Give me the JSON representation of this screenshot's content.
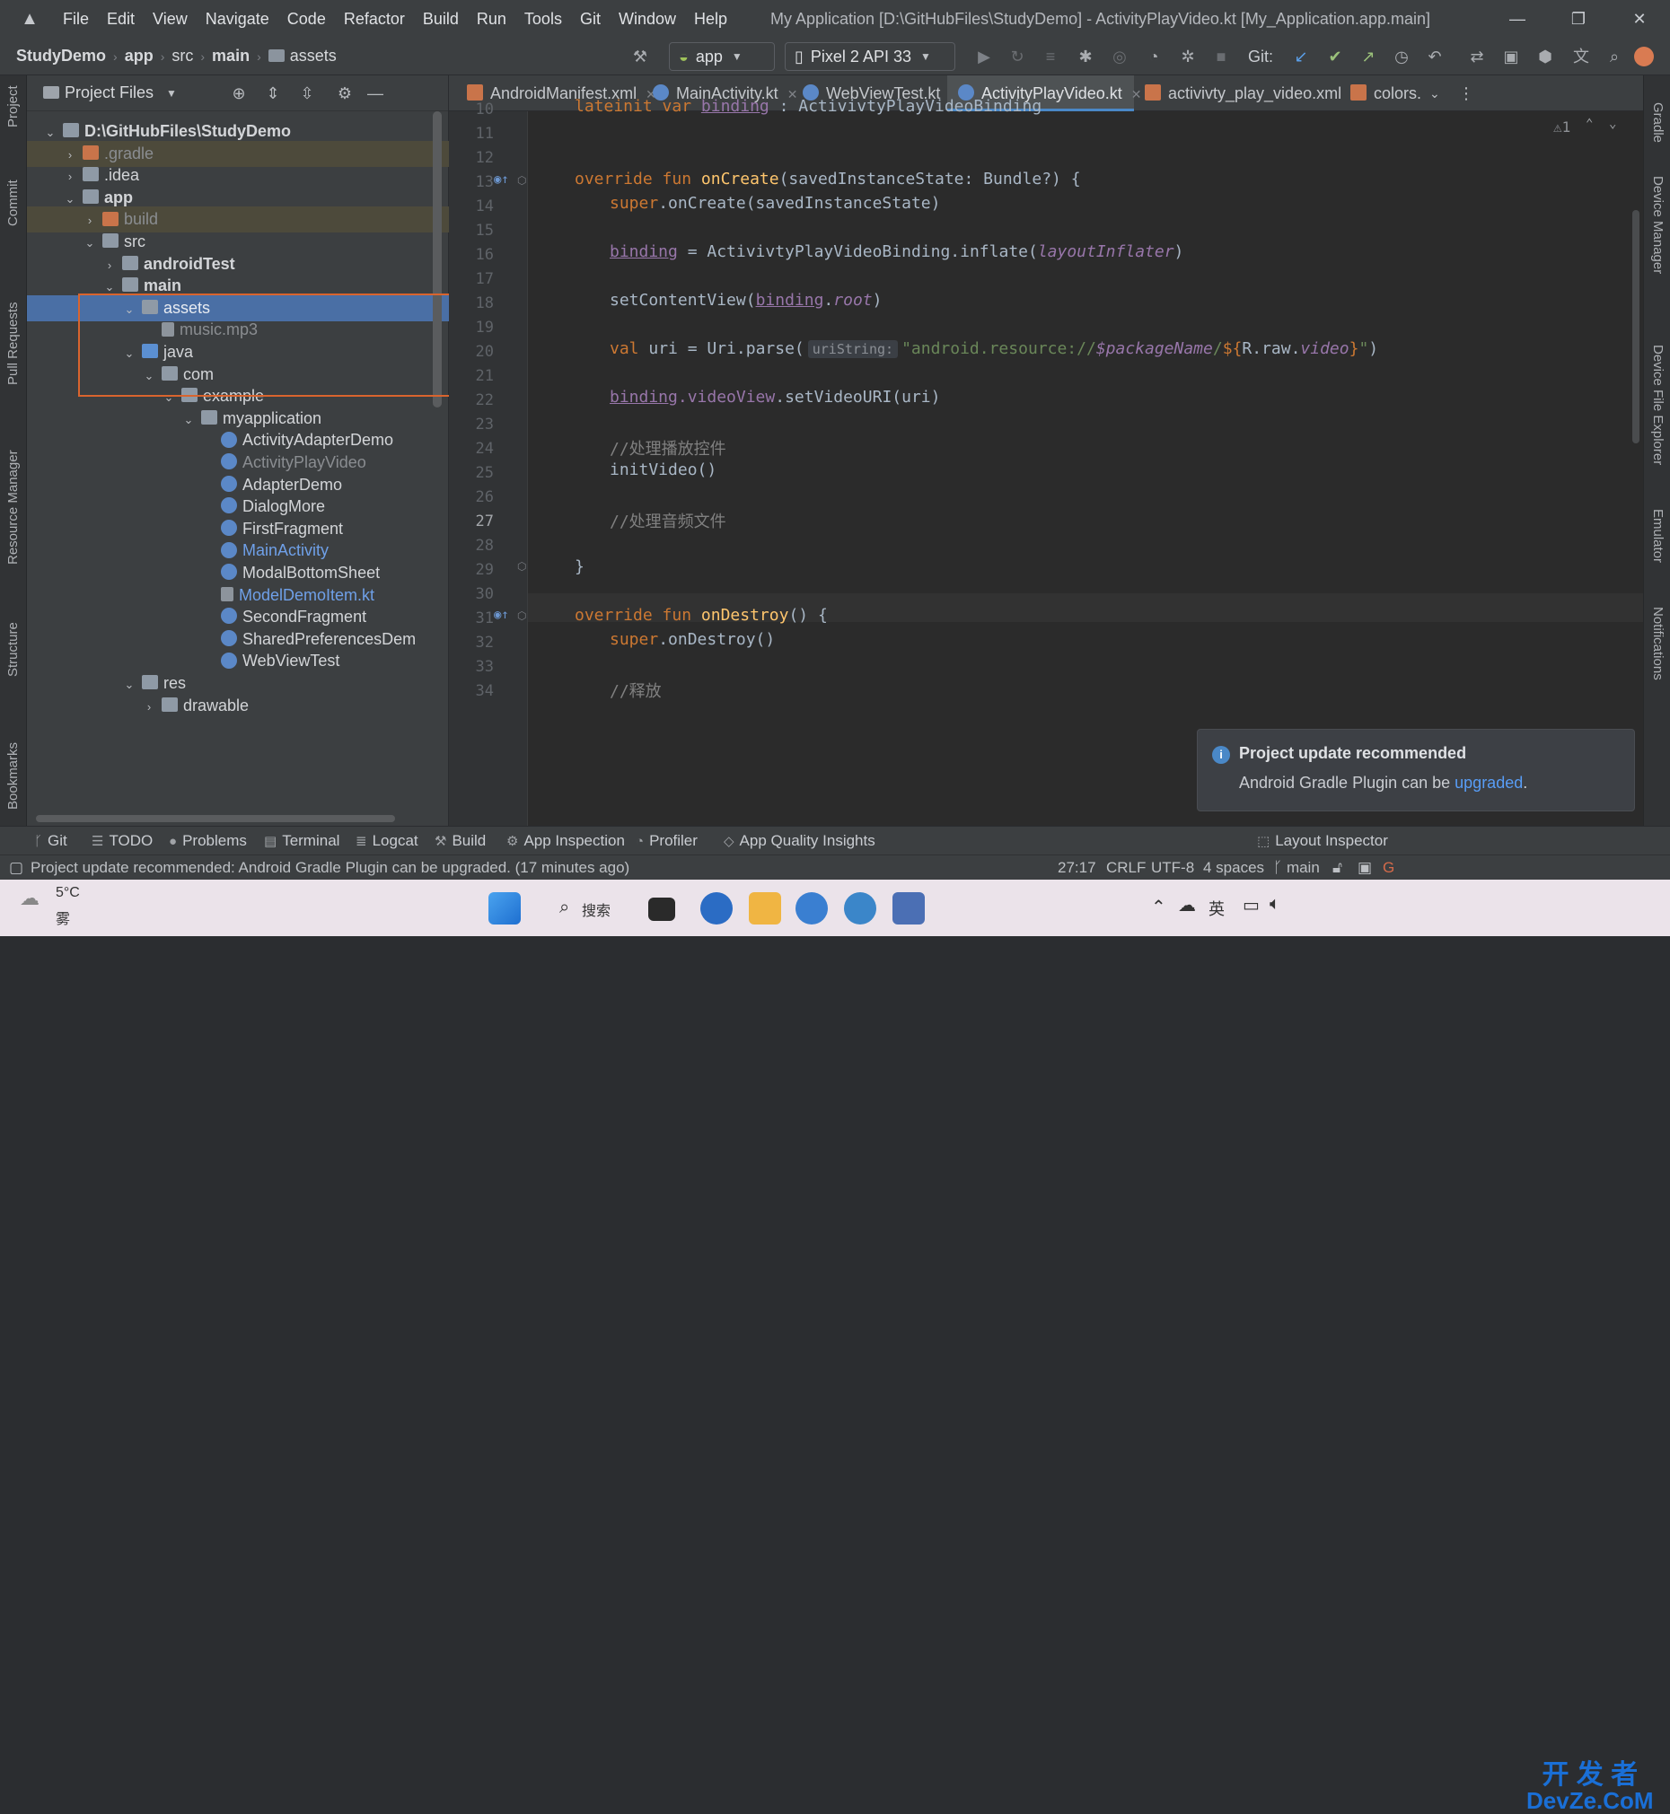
{
  "window": {
    "title": "My Application [D:\\GitHubFiles\\StudyDemo] - ActivityPlayVideo.kt [My_Application.app.main]",
    "menu": [
      "File",
      "Edit",
      "View",
      "Navigate",
      "Code",
      "Refactor",
      "Build",
      "Run",
      "Tools",
      "Git",
      "Window",
      "Help"
    ],
    "controls": [
      "—",
      "❐",
      "✕"
    ]
  },
  "breadcrumb": [
    "StudyDemo",
    "app",
    "src",
    "main",
    "assets"
  ],
  "toolbar": {
    "run_config": "app",
    "device": "Pixel 2 API 33",
    "git_label": "Git:"
  },
  "left_stripe": [
    "Project",
    "Commit",
    "Pull Requests",
    "Resource Manager",
    "Structure",
    "Bookmarks"
  ],
  "right_stripe": [
    "Gradle",
    "Device Manager",
    "Device File Explorer",
    "Emulator",
    "Notifications"
  ],
  "project": {
    "header": "Project Files",
    "tree": [
      {
        "label": "D:\\GitHubFiles\\StudyDemo",
        "arrow": "⌄",
        "icon": "folder",
        "style": "b"
      },
      {
        "label": ".gradle",
        "arrow": "›",
        "icon": "ofolder",
        "style": "dim"
      },
      {
        "label": ".idea",
        "arrow": "›",
        "icon": "folder",
        "style": ""
      },
      {
        "label": "app",
        "arrow": "⌄",
        "icon": "folder",
        "style": "b"
      },
      {
        "label": "build",
        "arrow": "›",
        "icon": "ofolder",
        "style": "dim"
      },
      {
        "label": "src",
        "arrow": "⌄",
        "icon": "folder",
        "style": ""
      },
      {
        "label": "androidTest",
        "arrow": "›",
        "icon": "folder",
        "style": "b"
      },
      {
        "label": "main",
        "arrow": "⌄",
        "icon": "folder",
        "style": "b"
      },
      {
        "label": "assets",
        "arrow": "⌄",
        "icon": "folder",
        "style": "sel"
      },
      {
        "label": "music.mp3",
        "arrow": "",
        "icon": "file",
        "style": "dim"
      },
      {
        "label": "java",
        "arrow": "⌄",
        "icon": "bfolder",
        "style": ""
      },
      {
        "label": "com",
        "arrow": "⌄",
        "icon": "folder",
        "style": ""
      },
      {
        "label": "example",
        "arrow": "⌄",
        "icon": "folder",
        "style": ""
      },
      {
        "label": "myapplication",
        "arrow": "⌄",
        "icon": "folder",
        "style": ""
      },
      {
        "label": "ActivityAdapterDemo",
        "arrow": "",
        "icon": "kt",
        "style": ""
      },
      {
        "label": "ActivityPlayVideo",
        "arrow": "",
        "icon": "kt",
        "style": "dim"
      },
      {
        "label": "AdapterDemo",
        "arrow": "",
        "icon": "kt",
        "style": ""
      },
      {
        "label": "DialogMore",
        "arrow": "",
        "icon": "kt",
        "style": ""
      },
      {
        "label": "FirstFragment",
        "arrow": "",
        "icon": "kt",
        "style": ""
      },
      {
        "label": "MainActivity",
        "arrow": "",
        "icon": "kt",
        "style": "blue"
      },
      {
        "label": "ModalBottomSheet",
        "arrow": "",
        "icon": "kt",
        "style": ""
      },
      {
        "label": "ModelDemoItem.kt",
        "arrow": "",
        "icon": "file",
        "style": "blue"
      },
      {
        "label": "SecondFragment",
        "arrow": "",
        "icon": "kt",
        "style": ""
      },
      {
        "label": "SharedPreferencesDem",
        "arrow": "",
        "icon": "kt",
        "style": ""
      },
      {
        "label": "WebViewTest",
        "arrow": "",
        "icon": "kt",
        "style": ""
      },
      {
        "label": "res",
        "arrow": "⌄",
        "icon": "folder",
        "style": ""
      },
      {
        "label": "drawable",
        "arrow": "›",
        "icon": "folder",
        "style": ""
      }
    ]
  },
  "tabs": [
    {
      "label": "AndroidManifest.xml",
      "color": "#c9744a"
    },
    {
      "label": "MainActivity.kt",
      "color": "#5b88c7"
    },
    {
      "label": "WebViewTest.kt",
      "color": "#5b88c7"
    },
    {
      "label": "ActivityPlayVideo.kt",
      "color": "#5b88c7"
    },
    {
      "label": "activivty_play_video.xml",
      "color": "#c9744a"
    },
    {
      "label": "colors.",
      "color": "#c9744a"
    }
  ],
  "editor": {
    "line_numbers": [
      "10",
      "11",
      "12",
      "13",
      "14",
      "15",
      "16",
      "17",
      "18",
      "19",
      "20",
      "21",
      "22",
      "23",
      "24",
      "25",
      "26",
      "27",
      "28",
      "29",
      "30",
      "31",
      "32",
      "33",
      "34"
    ],
    "current_line": "27",
    "warning_count": "⚠1",
    "code": {
      "l10_a": "lateinit var ",
      "l10_b": "binding",
      "l10_c": " : ActivivtyPlayVideoBinding",
      "l13_a": "override fun ",
      "l13_b": "onCreate",
      "l13_c": "(savedInstanceState: Bundle?) {",
      "l14_a": "super",
      "l14_b": ".onCreate(savedInstanceState)",
      "l16_a": "binding",
      "l16_b": " = ActivivtyPlayVideoBinding.inflate(",
      "l16_c": "layoutInflater",
      "l16_d": ")",
      "l18_a": "setContentView(",
      "l18_b": "binding",
      "l18_c": ".",
      "l18_d": "root",
      "l18_e": ")",
      "l20_a": "val ",
      "l20_b": "uri = Uri.parse(",
      "l20_hint": "uriString:",
      "l20_c": "\"android.resource://",
      "l20_d": "$packageName",
      "l20_e": "/",
      "l20_f": "${",
      "l20_g": "R.raw.",
      "l20_h": "video",
      "l20_i": "}",
      "l20_j": "\"",
      "l20_k": ")",
      "l22_a": "binding",
      "l22_b": ".videoView",
      "l22_c": ".setVideoURI(uri)",
      "l24": "//处理播放控件",
      "l25": "initVideo()",
      "l27": "//处理音频文件",
      "l29": "}",
      "l31_a": "override fun ",
      "l31_b": "onDestroy",
      "l31_c": "() {",
      "l32_a": "super",
      "l32_b": ".onDestroy()",
      "l34": "//释放"
    }
  },
  "notification": {
    "title": "Project update recommended",
    "body": "Android Gradle Plugin can be ",
    "link": "upgraded",
    "end": "."
  },
  "bottom_tools": [
    "Git",
    "TODO",
    "Problems",
    "Terminal",
    "Logcat",
    "Build",
    "App Inspection",
    "Profiler",
    "App Quality Insights",
    "Layout Inspector"
  ],
  "status": {
    "message": "Project update recommended: Android Gradle Plugin can be upgraded. (17 minutes ago)",
    "position": "27:17",
    "line_sep": "CRLF",
    "encoding": "UTF-8",
    "indent": "4 spaces",
    "branch": "main"
  },
  "taskbar": {
    "temp": "5°C",
    "weather": "雾",
    "search": "搜索",
    "ime": "英",
    "watermark_top": "开 发 者",
    "watermark_bottom": "DevZe.CoM"
  }
}
